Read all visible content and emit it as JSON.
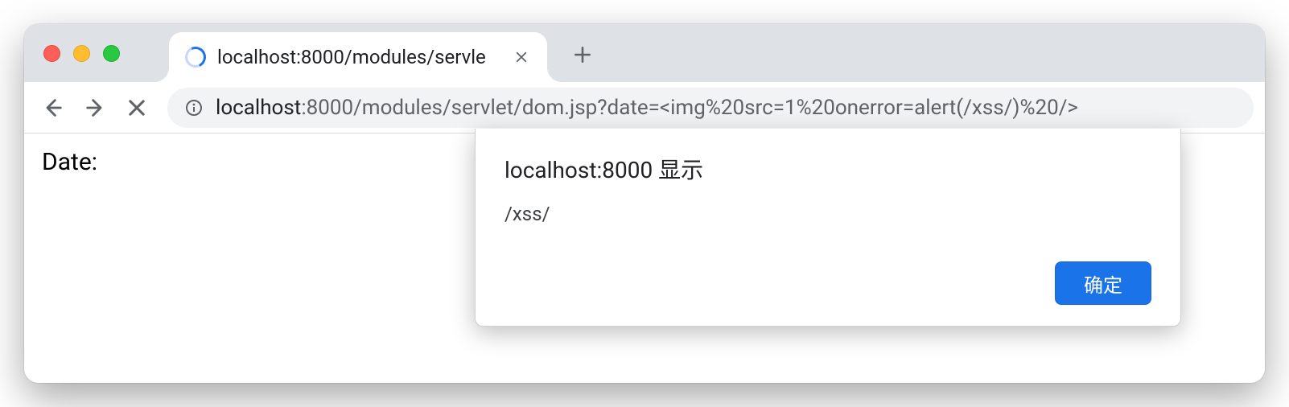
{
  "tab": {
    "title": "localhost:8000/modules/servle"
  },
  "url": {
    "host": "localhost",
    "rest": ":8000/modules/servlet/dom.jsp?date=<img%20src=1%20onerror=alert(/xss/)%20/>"
  },
  "page": {
    "label": "Date:"
  },
  "alert": {
    "title": "localhost:8000 显示",
    "message": "/xss/",
    "ok_label": "确定"
  }
}
